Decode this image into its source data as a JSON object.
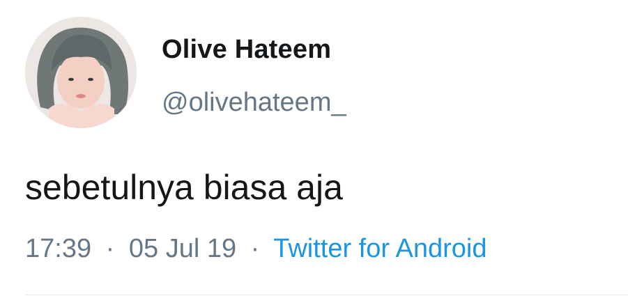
{
  "tweet": {
    "display_name": "Olive Hateem",
    "handle": "@olivehateem_",
    "text": "sebetulnya biasa aja",
    "time": "17:39",
    "date": "05 Jul 19",
    "separator": "·",
    "source": "Twitter for Android",
    "avatar_icon": "profile-photo"
  },
  "colors": {
    "text_primary": "#14171a",
    "text_secondary": "#657786",
    "link": "#1b95e0",
    "divider": "#e6ecf0",
    "background": "#ffffff"
  }
}
